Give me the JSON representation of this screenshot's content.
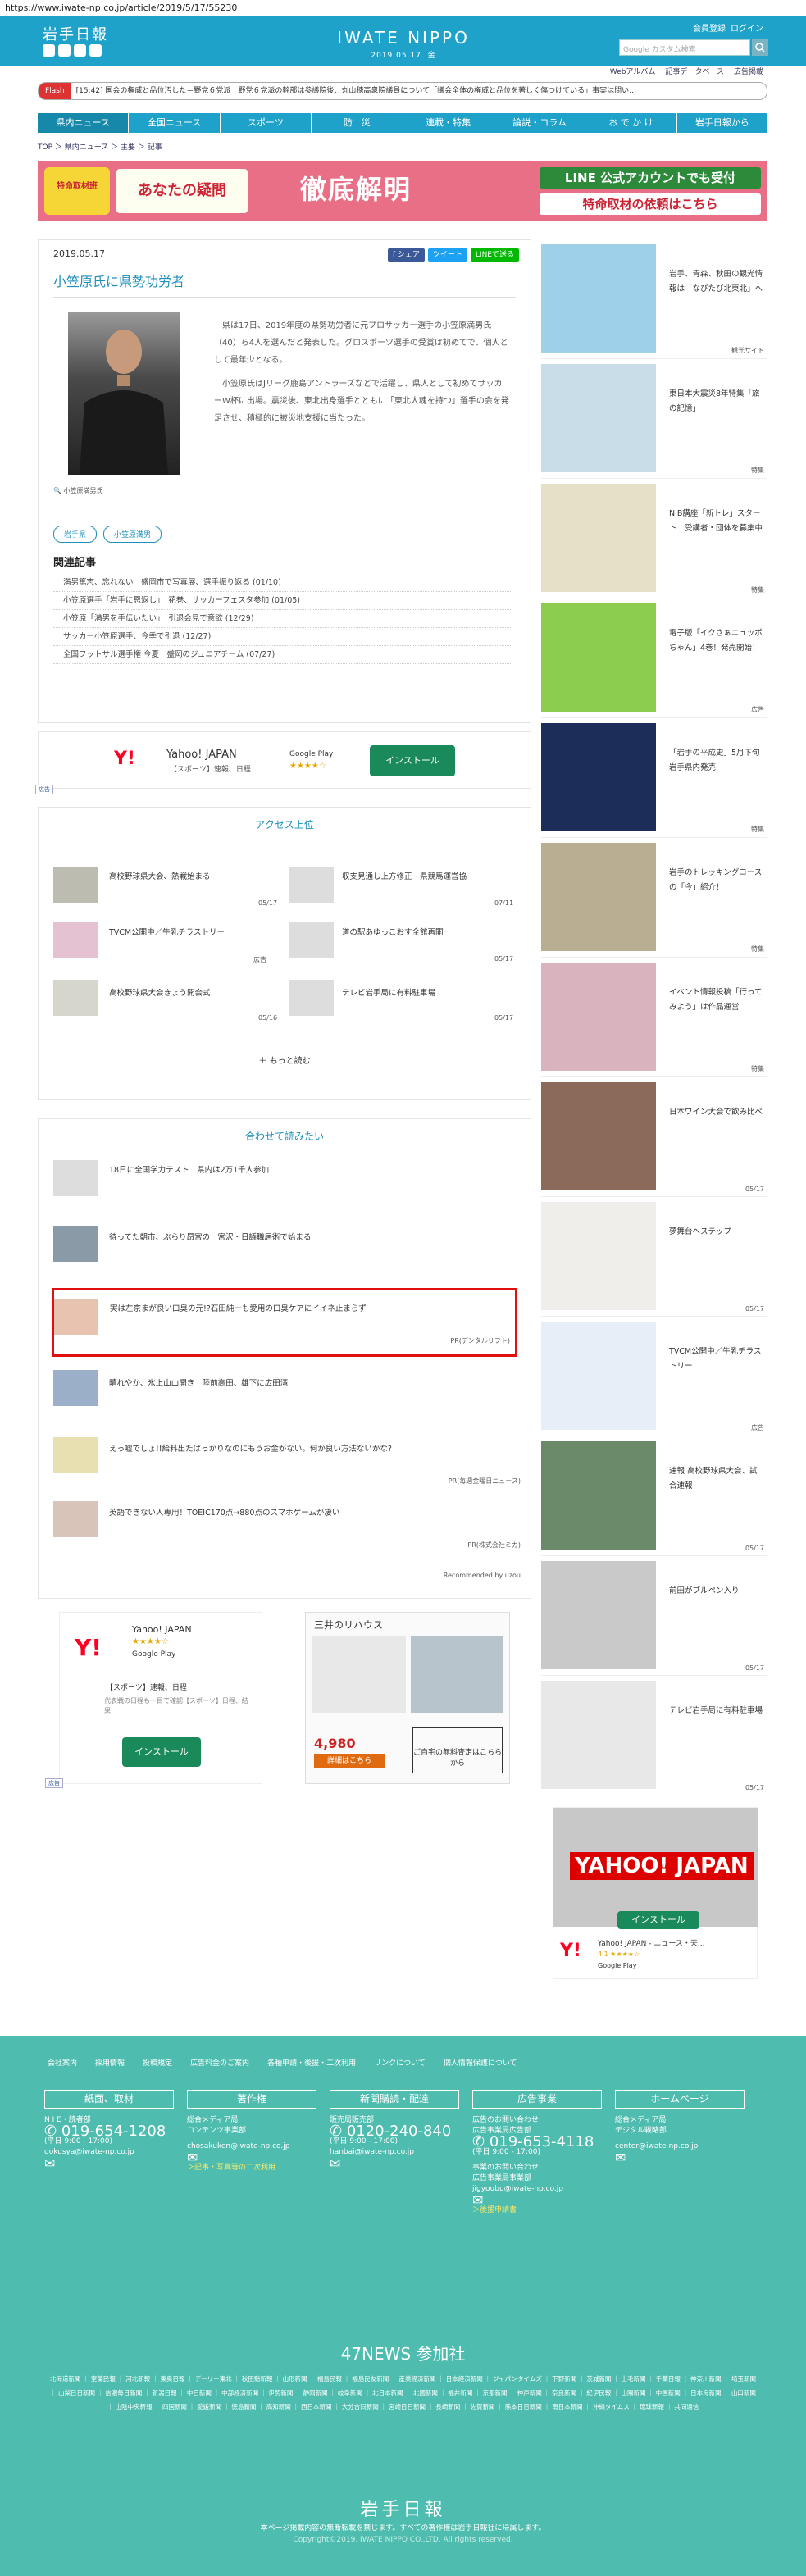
{
  "url": "https://www.iwate-np.co.jp/article/2019/5/17/55230",
  "header": {
    "logo": "岩手日報",
    "brand": "IWATE NIPPO",
    "date": "2019.05.17. 金",
    "links": [
      "会員登録",
      "ログイン"
    ],
    "search_placeholder": "Google カスタム検索"
  },
  "subnav": [
    "Webアルバム",
    "記事データベース",
    "広告掲載"
  ],
  "flash": {
    "label": "Flash",
    "text": "[15:42] 国会の権威と品位汚した＝野党６党派　野党６党派の幹部は参議院後、丸山穂高衆院議員について「議会全体の権威と品位を著しく傷つけている」事実は問い…"
  },
  "nav": [
    "県内ニュース",
    "全国ニュース",
    "スポーツ",
    "防　災",
    "連載・特集",
    "論説・コラム",
    "お で か け",
    "岩手日報から"
  ],
  "breadcrumb": "TOP ＞ 県内ニュース ＞ 主要 ＞ 記事",
  "banner": {
    "left": "特命取材班",
    "middle": "あなたの疑問",
    "main": "徹底解明",
    "right1": "LINE 公式アカウントでも受付",
    "right2": "特命取材の依頼はこちら"
  },
  "article": {
    "date": "2019.05.17",
    "share": [
      "f シェア",
      "ツイート",
      "LINEで送る"
    ],
    "title": "小笠原氏に県勢功労者",
    "caption": "小笠原満男氏",
    "paragraphs": [
      "県は17日、2019年度の県勢功労者に元プロサッカー選手の小笠原満男氏（40）ら4人を選んだと発表した。グロスポーツ選手の受賞は初めてで、個人として最年少となる。",
      "小笠原氏はJリーグ鹿島アントラーズなどで活躍し、県人として初めてサッカーW杯に出場。震災後、東北出身選手とともに「東北人魂を持つ」選手の会を発足させ、積極的に被災地支援に当たった。"
    ],
    "tags": [
      "岩手県",
      "小笠原満男"
    ],
    "related_title": "関連記事",
    "related": [
      "満男篤志、忘れない　盛岡市で写真展、選手振り返る (01/10)",
      "小笠原選手「岩手に恩返し」　花巻、サッカーフェスタ参加 (01/05)",
      "小笠原「満男を手伝いたい」　引退会見で意欲 (12/29)",
      "サッカー小笠原選手、今季で引退 (12/27)",
      "全国フットサル選手権 今夏　盛岡のジュニアチーム (07/27)"
    ]
  },
  "ad1": {
    "name": "Yahoo! JAPAN",
    "sub": "【スポーツ】速報、日程",
    "rating": "★★★★☆",
    "store": "Google Play",
    "button": "インストール",
    "tag": "広告"
  },
  "ranking": {
    "title": "アクセス上位",
    "items": [
      {
        "t": "高校野球県大会、熱戦始まる",
        "d": "05/17"
      },
      {
        "t": "収支見通し上方修正　県競馬運営協",
        "d": "07/11"
      },
      {
        "t": "TVCM公開中／牛乳チラストリー",
        "d": "広告"
      },
      {
        "t": "道の駅あゆっこおす全館再開",
        "d": "05/17"
      },
      {
        "t": "高校野球県大会きょう開会式",
        "d": "05/16"
      },
      {
        "t": "テレビ岩手局に有料駐車場",
        "d": "05/17"
      }
    ],
    "more": "もっと読む"
  },
  "recommend": {
    "title": "合わせて読みたい",
    "items": [
      {
        "t": "18日に全国学力テスト　県内は2万1千人参加",
        "s": ""
      },
      {
        "t": "待ってた朝市、ぶらり昂宮の　宮沢・日議職居術で始まる",
        "s": ""
      },
      {
        "t": "実は左京まが良い口臭の元!?石田純一も愛用の口臭ケアにイイネ止まらず",
        "s": "PR(デンタルリフト)"
      },
      {
        "t": "晴れやか、氷上山山開き　陸前高田、雄下に広田湾",
        "s": ""
      },
      {
        "t": "えっ嘘でしょ!!給料出たばっかりなのにもうお金がない。何か良い方法ないかな?",
        "s": "PR(毎週金曜日ニュース)"
      },
      {
        "t": "英語できない人専用！TOEIC170点→880点のスマホゲームが凄い",
        "s": "PR(株式会社ミカ)"
      }
    ],
    "powered": "Recommended by uzou"
  },
  "ad2": {
    "name": "Yahoo! JAPAN",
    "rating": "★★★★☆",
    "store": "Google Play",
    "sub": "【スポーツ】速報、日程",
    "desc": "代表戦の日程も一目で確認【スポーツ】日程、結果",
    "button": "インストール",
    "tag": "広告"
  },
  "ad3": {
    "title": "三井のリハウス",
    "price": "4,980",
    "btn": "詳細はこちら",
    "q": "ご自宅の無料査定はこちらから"
  },
  "sidebar": [
    {
      "t": "岩手、青森、秋田の観光情報は「なびたび北東北」へ",
      "d": "観光サイト",
      "c": "#9fd0ea"
    },
    {
      "t": "東日本大震災8年特集「旅の記憶」",
      "d": "特集",
      "c": "#c8dde8"
    },
    {
      "t": "NIB講座「新トレ」スタート　受講者・団体を募集中",
      "d": "特集",
      "c": "#e7e0c8"
    },
    {
      "t": "電子版「イクさぁニュッポちゃん」4巻！発売開始！",
      "d": "広告",
      "c": "#8ccc4e"
    },
    {
      "t": "「岩手の平成史」5月下旬岩手県内発売",
      "d": "特集",
      "c": "#1d2d5a"
    },
    {
      "t": "岩手のトレッキングコースの「今」紹介！",
      "d": "特集",
      "c": "#b9ae92"
    },
    {
      "t": "イベント情報投稿「行ってみよう」は作品運営",
      "d": "特集",
      "c": "#d9b4be"
    },
    {
      "t": "日本ワイン大会で飲み比べ",
      "d": "05/17",
      "c": "#8c6a5a"
    },
    {
      "t": "夢舞台へステップ",
      "d": "05/17",
      "c": "#f0eeea"
    },
    {
      "t": "TVCM公開中／牛乳チラストリー",
      "d": "広告",
      "c": "#e6eef8"
    },
    {
      "t": "速報 高校野球県大会、試合速報",
      "d": "05/17",
      "c": "#6a8a6a"
    },
    {
      "t": "前田がブルペン入り",
      "d": "05/17",
      "c": "#c9c9c9"
    },
    {
      "t": "テレビ岩手局に有料駐車場",
      "d": "05/17",
      "c": "#e8e8e8"
    }
  ],
  "ad4": {
    "logo": "YAHOO! JAPAN",
    "button": "インストール",
    "name": "Yahoo! JAPAN - ニュース・天...",
    "rating": "4.1 ★★★★☆",
    "store": "Google Play"
  },
  "footer": {
    "links": [
      "会社案内",
      "採用情報",
      "投稿規定",
      "広告料金のご案内",
      "各種申請・後援・二次利用",
      "リンクについて",
      "個人情報保護について"
    ],
    "cols": [
      {
        "h": "紙面、取材",
        "l1": "N I E・読者部",
        "ph": "019-654-1208",
        "l2": "(平日 9:00 - 17:00)",
        "mail": "dokusya@iwate-np.co.jp"
      },
      {
        "h": "著作権",
        "l1": "総合メディア局\nコンテンツ事業部",
        "mail": "chosakuken@iwate-np.co.jp",
        "l2": "＞記事・写真等の二次利用"
      },
      {
        "h": "新聞購読・配達",
        "l1": "販売局販売部",
        "ph": "0120-240-840",
        "l2": "(平日 9:00 - 17:00)",
        "mail": "hanbai@iwate-np.co.jp"
      },
      {
        "h": "広告事業",
        "l1": "広告のお問い合わせ\n広告事業局広告部",
        "ph": "019-653-4118",
        "l2": "(平日 9:00 - 17:00)",
        "l3": "事業のお問い合わせ\n広告事業局事業部",
        "mail": "jigyoubu@iwate-np.co.jp",
        "l4": "＞後援申請書"
      },
      {
        "h": "ホームページ",
        "l1": "総合メディア局\nデジタル戦略部",
        "mail": "center@iwate-np.co.jp"
      }
    ],
    "n47": "47NEWS 参加社",
    "papers": "北海道新聞 ｜ 室蘭民報 ｜ 河北新報 ｜ 東奥日報 ｜ デーリー東北 ｜ 秋田魁新報 ｜ 山形新聞 ｜ 福島民報 ｜ 福島民友新聞 ｜ 産業経済新聞 ｜ 日本経済新聞 ｜ ジャパンタイムズ ｜ 下野新聞 ｜ 茨城新聞 ｜ 上毛新聞 ｜ 千葉日報 ｜ 神奈川新聞 ｜ 埼玉新聞 ｜ 山梨日日新聞 ｜ 信濃毎日新聞 ｜ 新潟日報 ｜ 中日新聞 ｜ 中部経済新聞 ｜ 伊勢新聞 ｜ 静岡新聞 ｜ 岐阜新聞 ｜ 北日本新聞 ｜ 北國新聞 ｜ 福井新聞 ｜ 京都新聞 ｜ 神戸新聞 ｜ 奈良新聞 ｜ 紀伊民報 ｜ 山陽新聞 ｜ 中国新聞 ｜ 日本海新聞 ｜ 山口新聞 ｜ 山陰中央新報 ｜ 四国新聞 ｜ 愛媛新聞 ｜ 徳島新聞 ｜ 高知新聞 ｜ 西日本新聞 ｜ 大分合同新聞 ｜ 宮崎日日新聞 ｜ 長崎新聞 ｜ 佐賀新聞 ｜ 熊本日日新聞 ｜ 南日本新聞 ｜ 沖縄タイムス ｜ 琉球新報 ｜ 共同通信",
    "logo": "岩手日報",
    "copy1": "本ページ掲載内容の無断転載を禁じます。すべての著作権は岩手日報社に帰属します。",
    "copy2": "Copyright©2019, IWATE NIPPO CO.,LTD. All rights reserved."
  }
}
